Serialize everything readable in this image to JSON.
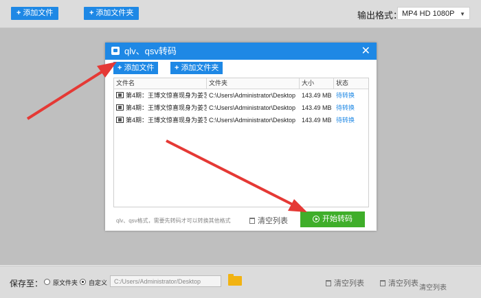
{
  "toolbar": {
    "add_file": "添加文件",
    "add_folder": "添加文件夹",
    "output_format_label": "输出格式：",
    "output_format_value": "MP4  HD 1080P"
  },
  "dialog": {
    "title": "qlv、qsv转码",
    "add_file": "添加文件",
    "add_folder": "添加文件夹",
    "columns": [
      "文件名",
      "文件夹",
      "大小",
      "状态"
    ],
    "rows": [
      {
        "name": "第4期：王博文惊喜现身为姜艺",
        "folder": "C:\\Users\\Administrator\\Desktop",
        "size": "143.49 MB",
        "status": "待转换"
      },
      {
        "name": "第4期：王博文惊喜现身为姜艺",
        "folder": "C:\\Users\\Administrator\\Desktop",
        "size": "143.49 MB",
        "status": "待转换"
      },
      {
        "name": "第4期：王博文惊喜现身为姜艺",
        "folder": "C:\\Users\\Administrator\\Desktop",
        "size": "143.49 MB",
        "status": "待转换"
      }
    ],
    "hint": "qlv、qsv格式，需要先转码才可以转换其他格式",
    "clear_list": "清空列表",
    "start": "开始转码"
  },
  "bottom": {
    "save_to": "保存至：",
    "option_original": "原文件夹",
    "option_custom": "自定义",
    "path": "C:/Users/Administrator/Desktop",
    "clear_list_1": "清空列表",
    "clear_list_2": "清空列表",
    "clear_list_3": "清空列表"
  },
  "colors": {
    "accent": "#1e88e5",
    "start_green": "#3fae2a",
    "arrow_red": "#e53935"
  }
}
